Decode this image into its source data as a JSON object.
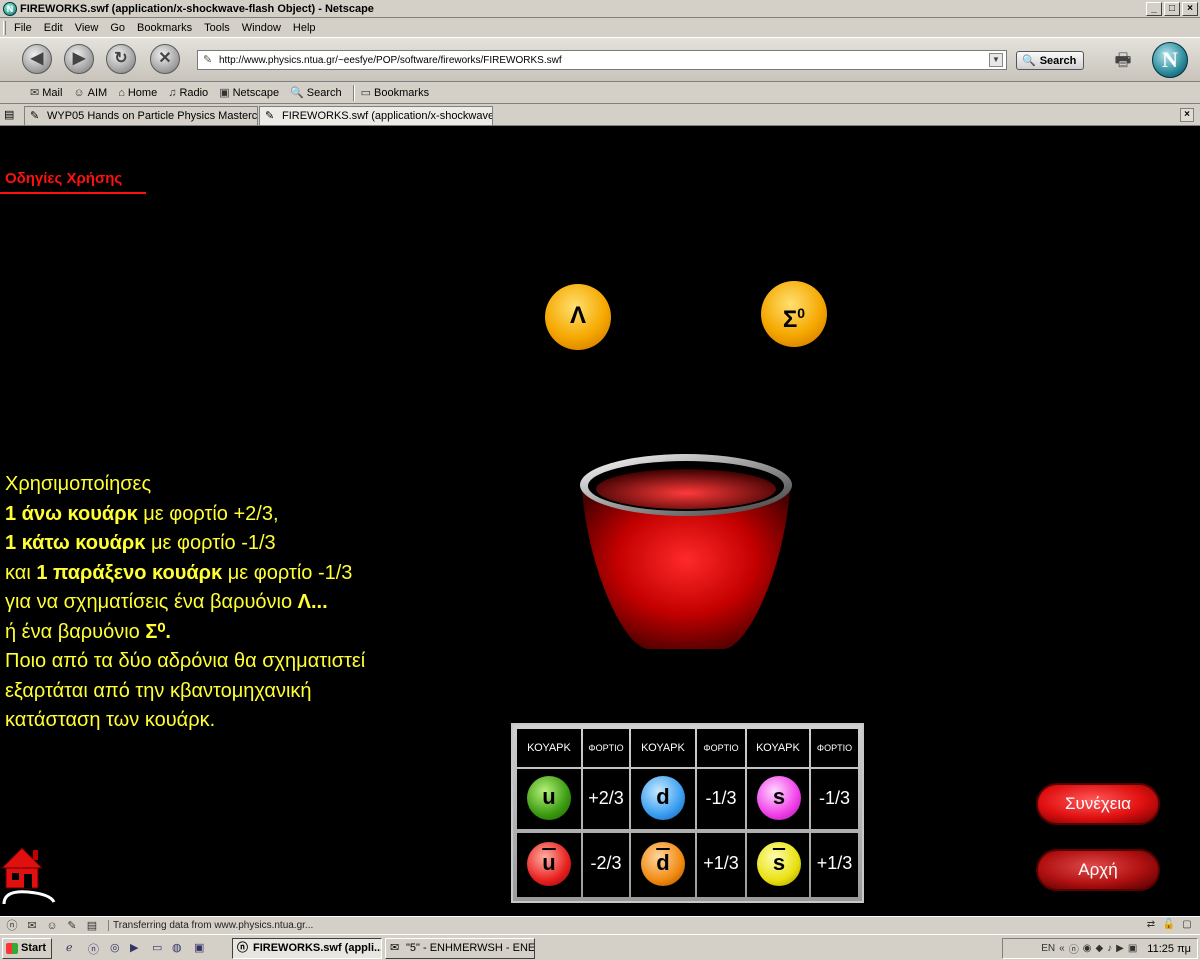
{
  "window": {
    "title": "FIREWORKS.swf (application/x-shockwave-flash Object) - Netscape",
    "controls": {
      "minimize": "_",
      "maximize": "□",
      "close": "×"
    }
  },
  "menu": {
    "items": [
      "File",
      "Edit",
      "View",
      "Go",
      "Bookmarks",
      "Tools",
      "Window",
      "Help"
    ]
  },
  "nav": {
    "url": "http://www.physics.ntua.gr/~eesfye/POP/software/fireworks/FIREWORKS.swf",
    "search_label": "Search",
    "logo_letter": "N"
  },
  "personal_toolbar": {
    "items": [
      "Mail",
      "AIM",
      "Home",
      "Radio",
      "Netscape",
      "Search",
      "Bookmarks"
    ]
  },
  "tabs": [
    {
      "label": "WYP05 Hands on Particle Physics Mastercla..."
    },
    {
      "label": "FIREWORKS.swf (application/x-shockwave..."
    }
  ],
  "flash": {
    "instructions_link": "Οδηγίες Χρήσης",
    "baryons": [
      {
        "symbol": "Λ",
        "sup": ""
      },
      {
        "symbol": "Σ",
        "sup": "0"
      }
    ],
    "lines": [
      {
        "pre": "Χρησιμοποίησες",
        "bold": "",
        "post": ""
      },
      {
        "pre": "",
        "bold": "1 άνω κουάρκ",
        "post": " με φορτίο +2/3,"
      },
      {
        "pre": "",
        "bold": "1 κάτω κουάρκ",
        "post": " με φορτίο -1/3"
      },
      {
        "pre": "και ",
        "bold": "1 παράξενο κουάρκ",
        "post": " με φορτίο -1/3"
      },
      {
        "pre": "για να σχηματίσεις ένα βαρυόνιο ",
        "bold": "Λ...",
        "post": ""
      },
      {
        "pre": "ή ένα βαρυόνιο ",
        "bold": "Σ⁰.",
        "post": ""
      },
      {
        "pre": "Ποιο από τα δύο αδρόνια θα σχηματιστεί",
        "bold": "",
        "post": ""
      },
      {
        "pre": "εξαρτάται από την κβαντομηχανική",
        "bold": "",
        "post": ""
      },
      {
        "pre": "κατάσταση των κουάρκ.",
        "bold": "",
        "post": ""
      }
    ],
    "table": {
      "headers": [
        "ΚΟΥΑΡΚ",
        "ΦΟΡΤΙΟ",
        "ΚΟΥΑΡΚ",
        "ΦΟΡΤΙΟ",
        "ΚΟΥΑΡΚ",
        "ΦΟΡΤΙΟ"
      ],
      "row1": [
        {
          "quark": "u",
          "charge": "+2/3"
        },
        {
          "quark": "d",
          "charge": "-1/3"
        },
        {
          "quark": "s",
          "charge": "-1/3"
        }
      ],
      "row2": [
        {
          "quark": "u",
          "charge": "-2/3"
        },
        {
          "quark": "d",
          "charge": "+1/3"
        },
        {
          "quark": "s",
          "charge": "+1/3"
        }
      ]
    },
    "continue_label": "Συνέχεια",
    "start_label": "Αρχή"
  },
  "status": {
    "text": "Transferring data from www.physics.ntua.gr..."
  },
  "taskbar": {
    "start_label": "Start",
    "items": [
      {
        "label": "FIREWORKS.swf (appli..."
      },
      {
        "label": "\"5\" - ENHMERWSH - ENE..."
      }
    ],
    "tray_lang": "EN",
    "clock": "11:25 πμ"
  },
  "colors": {
    "flash_background": "#000000",
    "link_red": "#ff1010",
    "text_yellow": "#ffff33",
    "baryon_orange": "#f5a800"
  }
}
